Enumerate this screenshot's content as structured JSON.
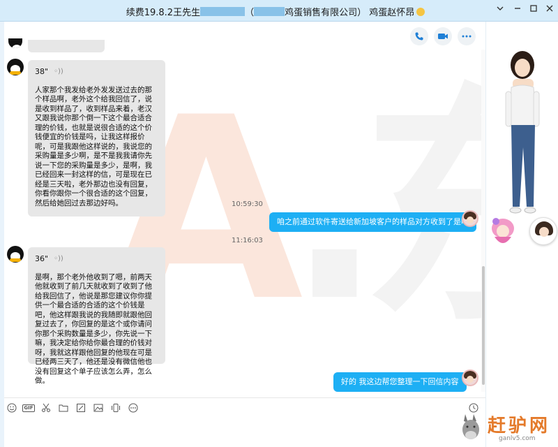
{
  "window": {
    "title_prefix": "续费19.8.2王先生",
    "title_mid_open": "（",
    "title_mid_company": "鸡蛋销售有限公司",
    "title_mid_close": "）",
    "title_suffix": "鸡蛋赵怀昂",
    "controls": [
      "chevron-down",
      "minimize",
      "maximize",
      "close"
    ]
  },
  "chat": {
    "header_icons": [
      "phone-icon",
      "video-icon",
      "more-icon"
    ],
    "watermark": "A.东昂",
    "messages": [
      {
        "side": "in",
        "voice_length": "38\"",
        "text": "人家那个我发给老外发发送过去的那个样品啊，老外这个给我回信了，说是收到样品了，收到样品来着，老汉又跟我说你那个倒一下这个最合适合理的价钱，也就是说很合适的这个价钱便宜的价钱是吗，让我这样报价呢，可是我跟他这样说的，我说您的采购量是多少啊，是不是我我请你先说一下您的采购量是多少，是啊，我已经回来一封这样的信，可是现在已经是三天啦，老外那边也没有回复，你看你跟你一个很合适的这个回复，然后给她回过去那边好吗。"
      },
      {
        "side": "time",
        "text": "10:59:30"
      },
      {
        "side": "out",
        "text": "咱之前通过软件寄送给新加坡客户的样品对方收到了是吗"
      },
      {
        "side": "time",
        "text": "11:16:03"
      },
      {
        "side": "in",
        "voice_length": "36\"",
        "text": "是啊，那个老外他收到了嗯，前两天他就收到了前几天就收到了收到了他给我回信了，他说是那您建议你你提供一个最合适的合适的这个价钱是吧，他这样跟我说的我随即就跟他回复过去了，你回复的是这个或你请问你那个采购数量是多少，你先说一下嘛，我决定给你给你最合理的价钱对呀，我就这样跟他回复的他现在可是已经两三天了，他还是没有微信他也没有回复这个单子应该怎么弄，怎么做。"
      },
      {
        "side": "out",
        "text": "好的  我这边帮您整理一下回信内容"
      }
    ]
  },
  "toolbar": {
    "tools": [
      "emoji-icon",
      "gif-icon",
      "scissors-icon",
      "folder-icon",
      "image-edit-icon",
      "image-icon",
      "shake-icon",
      "more-icon"
    ],
    "gif_label": "GIF",
    "history_icon": "clock-icon"
  },
  "branding": {
    "site_name": "赶驴网",
    "site_url": "ganlv5.com"
  },
  "colors": {
    "titlebar": "#d6ecfa",
    "bubble_out": "#1daff4",
    "bubble_in": "#e7e7e7",
    "brand": "#e47a2a"
  }
}
